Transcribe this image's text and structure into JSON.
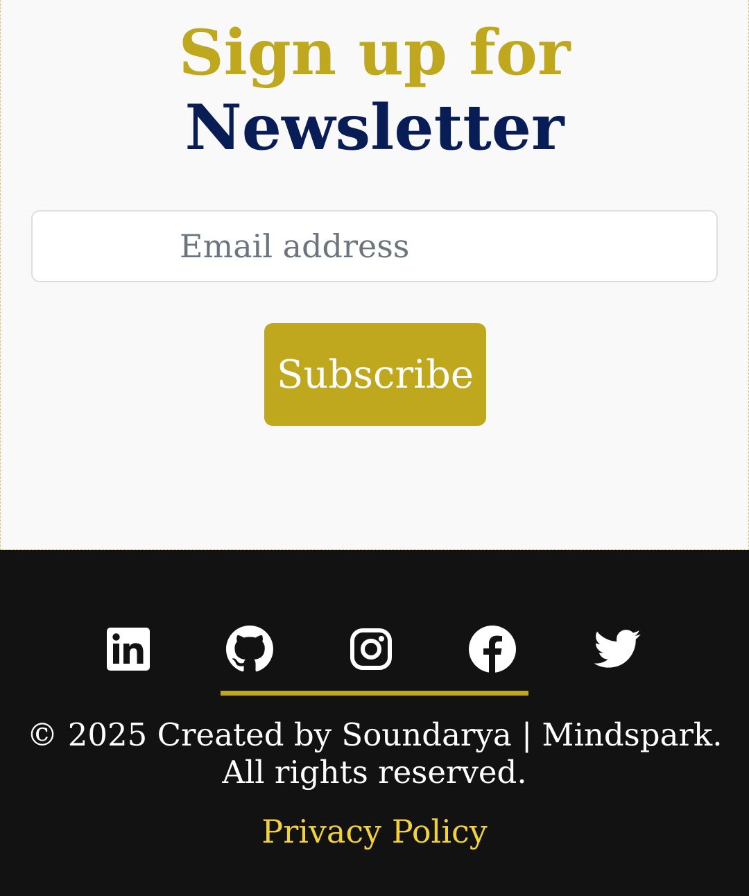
{
  "newsletter": {
    "title_line1": "Sign up for",
    "title_line2": "Newsletter",
    "email_placeholder": "Email address",
    "subscribe_label": "Subscribe"
  },
  "footer": {
    "social_icons": [
      "linkedin-icon",
      "github-icon",
      "instagram-icon",
      "facebook-icon",
      "twitter-icon"
    ],
    "copyright": "© 2025 Created by Soundarya | Mindspark. All rights reserved.",
    "privacy_label": "Privacy Policy"
  },
  "colors": {
    "accent_gold": "#bfa71e",
    "navy": "#081c56",
    "footer_bg": "#121212",
    "link_yellow": "#f1d23a"
  }
}
